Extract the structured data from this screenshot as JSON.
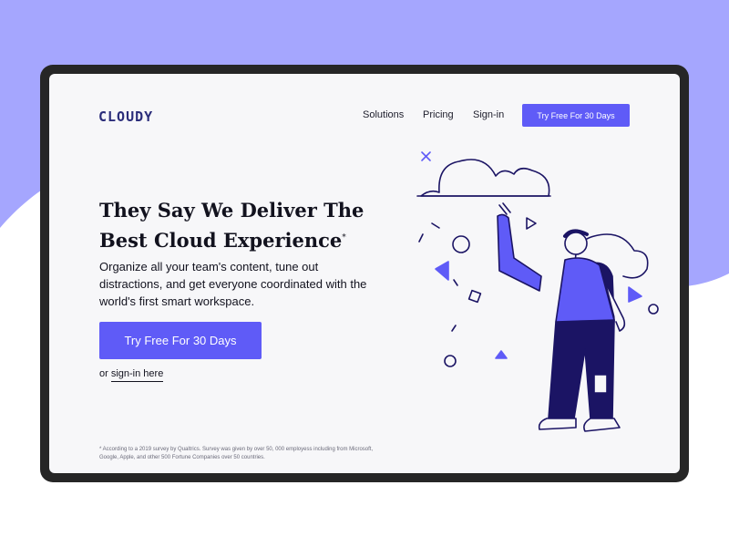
{
  "colors": {
    "accent": "#5f5bf7",
    "background_blob": "#a5a6fe",
    "frame": "#262626",
    "screen": "#f7f7f9",
    "ink": "#12121e",
    "navy": "#1b1464"
  },
  "header": {
    "logo": "CLOUDY",
    "nav": {
      "solutions": "Solutions",
      "pricing": "Pricing",
      "signin": "Sign-in"
    },
    "cta_label": "Try Free For 30 Days"
  },
  "hero": {
    "headline": "They Say We Deliver The Best Cloud Experience",
    "headline_mark": "*",
    "subtext": "Organize all your team's content, tune out distractions, and get everyone coordinated with the world's first smart workspace.",
    "cta_label": "Try Free For 30 Days",
    "alt_prefix": "or",
    "alt_link": "sign-in here"
  },
  "footnote": "* According to a 2019 survey by Qualtrics. Survey was given by over 50, 000 employess including from Microsoft, Google, Apple, and other 500 Fortune Companies over 50 countries.",
  "illustration": {
    "icons": [
      "cloud-icon",
      "person-icon",
      "triangle-icon",
      "circle-icon",
      "square-icon",
      "x-icon"
    ]
  }
}
